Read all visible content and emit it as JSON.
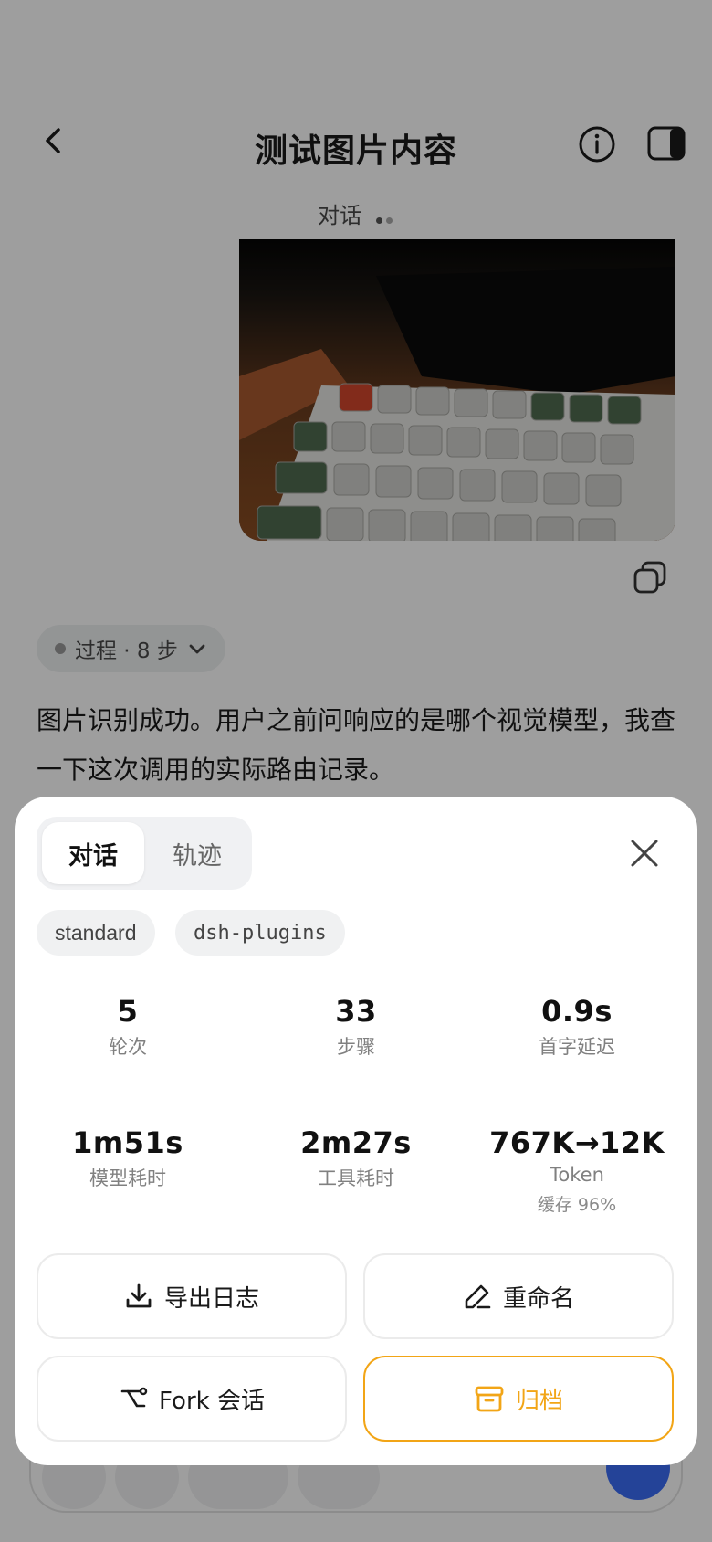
{
  "header": {
    "title": "测试图片内容"
  },
  "conversation": {
    "status_label": "对话"
  },
  "steps_chip": {
    "label": "过程 · 8 步"
  },
  "answer": {
    "text": "图片识别成功。用户之前问响应的是哪个视觉模型，我查一下这次调用的实际路由记录。"
  },
  "sheet": {
    "tabs": [
      {
        "label": "对话",
        "active": true
      },
      {
        "label": "轨迹",
        "active": false
      }
    ],
    "tags": [
      "standard",
      "dsh-plugins"
    ],
    "stats": [
      {
        "value": "5",
        "label": "轮次"
      },
      {
        "value": "33",
        "label": "步骤"
      },
      {
        "value": "0.9s",
        "label": "首字延迟"
      },
      {
        "value": "1m51s",
        "label": "模型耗时"
      },
      {
        "value": "2m27s",
        "label": "工具耗时"
      },
      {
        "value": "767K→12K",
        "label": "Token",
        "sub": "缓存 96%"
      }
    ],
    "actions": {
      "export_log": "导出日志",
      "rename": "重命名",
      "fork": "Fork 会话",
      "archive": "归档"
    }
  },
  "colors": {
    "accent": "#f2a516",
    "send_button": "#3b6cf6",
    "scrim": "rgba(0,0,0,0.38)"
  },
  "icons": [
    "back-icon",
    "info-icon",
    "side-panel-icon",
    "copy-icon",
    "chevron-down-icon",
    "close-icon",
    "download-icon",
    "pencil-icon",
    "fork-icon",
    "archive-icon"
  ]
}
